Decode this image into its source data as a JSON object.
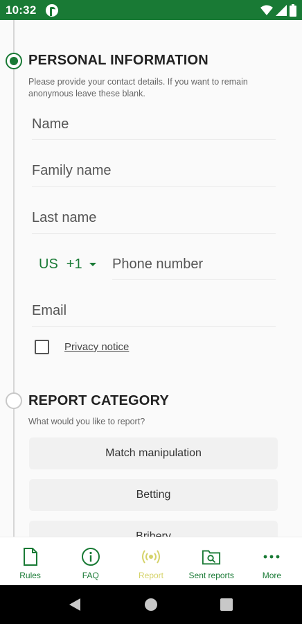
{
  "status_bar": {
    "time": "10:32"
  },
  "personal_information": {
    "title": "PERSONAL INFORMATION",
    "description": "Please provide your contact details. If you want to remain anonymous leave these blank.",
    "name_placeholder": "Name",
    "family_name_placeholder": "Family name",
    "last_name_placeholder": "Last name",
    "country_code": "US",
    "dial_code": "+1",
    "phone_placeholder": "Phone number",
    "email_placeholder": "Email",
    "privacy_notice": "Privacy notice",
    "privacy_checked": false
  },
  "report_category": {
    "title": "REPORT CATEGORY",
    "description": "What would you like to report?",
    "options": [
      "Match manipulation",
      "Betting",
      "Bribery"
    ]
  },
  "bottom_nav": {
    "items": [
      {
        "label": "Rules",
        "icon": "document-icon"
      },
      {
        "label": "FAQ",
        "icon": "info-icon"
      },
      {
        "label": "Report",
        "icon": "broadcast-icon",
        "active": true
      },
      {
        "label": "Sent reports",
        "icon": "folder-search-icon"
      },
      {
        "label": "More",
        "icon": "more-dots-icon"
      }
    ]
  },
  "colors": {
    "brand_green": "#197a35",
    "active_nav": "#d5d36a"
  }
}
